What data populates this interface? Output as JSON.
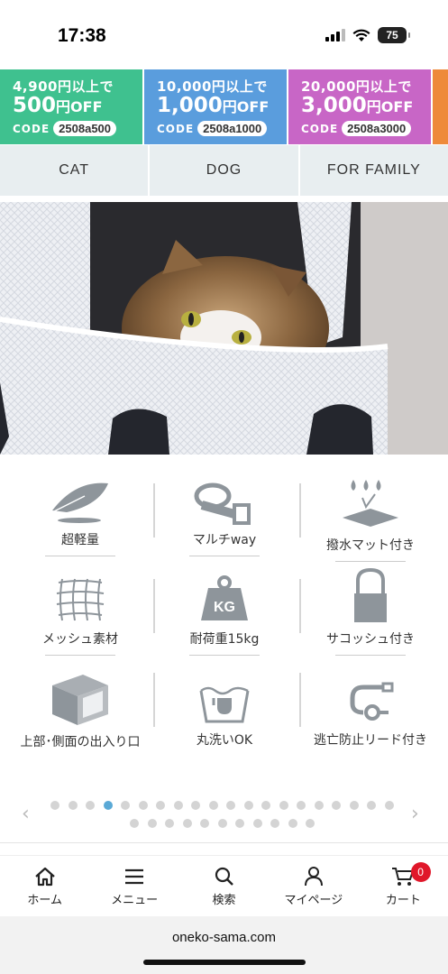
{
  "status_bar": {
    "time": "17:38",
    "battery": "75"
  },
  "coupons": [
    {
      "threshold": "4,900円以上で",
      "amount": "500",
      "unit": "円",
      "off": "OFF",
      "code_label": "CODE",
      "code": "2508a500",
      "color": "#3fc18f"
    },
    {
      "threshold": "10,000円以上で",
      "amount": "1,000",
      "unit": "円",
      "off": "OFF",
      "code_label": "CODE",
      "code": "2508a1000",
      "color": "#5a9ddd"
    },
    {
      "threshold": "20,000円以上で",
      "amount": "3,000",
      "unit": "円",
      "off": "OFF",
      "code_label": "CODE",
      "code": "2508a3000",
      "color": "#c866c6"
    }
  ],
  "tabs": [
    "CAT",
    "DOG",
    "FOR FAMILY"
  ],
  "hero": {
    "alt": ""
  },
  "features": [
    {
      "icon": "feather-icon",
      "label": "超軽量"
    },
    {
      "icon": "belt-icon",
      "label": "マルチway"
    },
    {
      "icon": "water-repellent-icon",
      "label": "撥水マット付き"
    },
    {
      "icon": "mesh-icon",
      "label": "メッシュ素材"
    },
    {
      "icon": "weight-icon",
      "label": "耐荷重15kg",
      "weight_text": "KG"
    },
    {
      "icon": "shoulder-bag-icon",
      "label": "サコッシュ付き"
    },
    {
      "icon": "box-icon",
      "label": "上部･側面の出入り口"
    },
    {
      "icon": "washable-icon",
      "label": "丸洗いOK"
    },
    {
      "icon": "leash-icon",
      "label": "逃亡防止リード付き"
    }
  ],
  "carousel": {
    "total_dots": 31,
    "active_index": 3
  },
  "bottom_nav": [
    {
      "icon": "home-icon",
      "label": "ホーム"
    },
    {
      "icon": "menu-icon",
      "label": "メニュー"
    },
    {
      "icon": "search-icon",
      "label": "検索"
    },
    {
      "icon": "user-icon",
      "label": "マイページ"
    },
    {
      "icon": "cart-icon",
      "label": "カート",
      "badge": "0"
    }
  ],
  "browser": {
    "url": "oneko-sama.com"
  },
  "colors": {
    "tab_bg": "#e8eef0",
    "icon_gray": "#8e959b",
    "active_dot": "#5aa9d6",
    "badge_red": "#e0172a"
  }
}
